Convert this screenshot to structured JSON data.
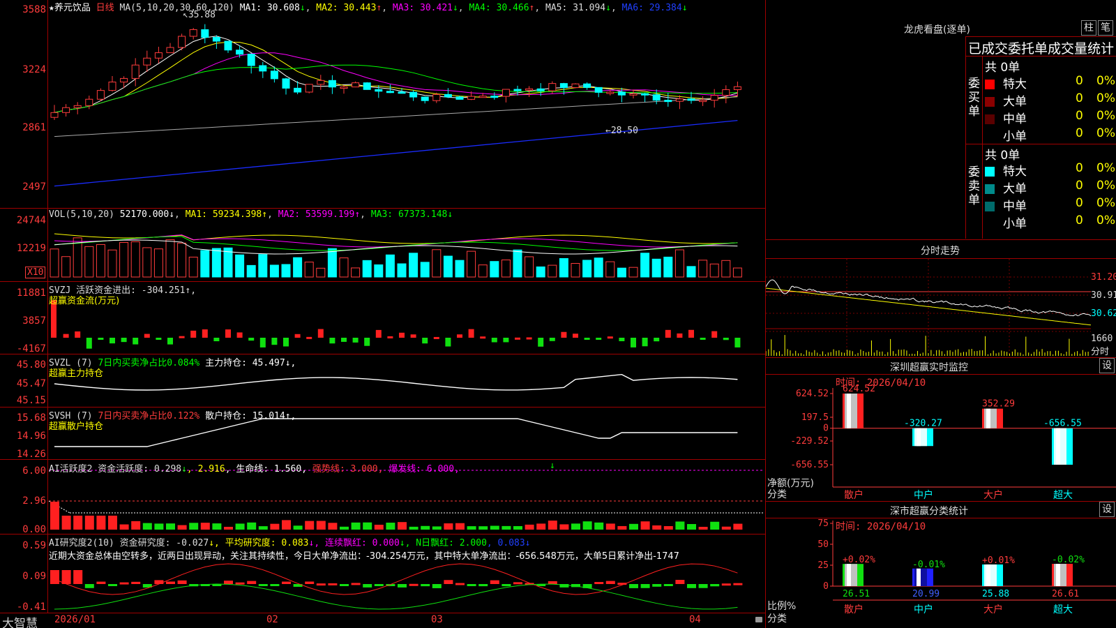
{
  "stock": {
    "name": "养元饮品",
    "period": "日线"
  },
  "main": {
    "ma_label": "MA(5,10,20,30,60,120)",
    "ma": [
      {
        "label": "MA1: 30.608",
        "dir": "↓",
        "color": "#ffffff"
      },
      {
        "label": "MA2: 30.443",
        "dir": "↑",
        "color": "#ffff00"
      },
      {
        "label": "MA3: 30.421",
        "dir": "↓",
        "color": "#ff00ff"
      },
      {
        "label": "MA4: 30.466",
        "dir": "↑",
        "color": "#00ff00"
      },
      {
        "label": "MA5: 31.094",
        "dir": "↓",
        "color": "#aaaaaa"
      },
      {
        "label": "MA6: 29.384",
        "dir": "↓",
        "color": "#0000ff"
      }
    ],
    "high_label": "35.88",
    "low_label": "28.50",
    "y_ticks": [
      "3588",
      "3224",
      "2861",
      "2497"
    ]
  },
  "vol": {
    "label": "VOL(5,10,20)",
    "value": "52170.000↓",
    "ma1": "MA1: 59234.398↑",
    "ma2": "MA2: 53599.199↑",
    "ma3": "MA3: 67373.148↓",
    "y_ticks": [
      "24744",
      "12219"
    ],
    "unit": "X10"
  },
  "svzj": {
    "title": "SVZJ  活跃资金进出: -304.251↑,",
    "subtitle": "超赢资金流(万元)",
    "y_ticks": [
      "11881",
      "3857",
      "-4167"
    ]
  },
  "svzl": {
    "title_a": "SVZL (7) ",
    "title_b": "7日内买卖净占比0.084%",
    "title_c": " 主力持仓: 45.497↓,",
    "subtitle": "超赢主力持仓",
    "y_ticks": [
      "45.80",
      "45.47",
      "45.15"
    ]
  },
  "svsh": {
    "title_a": "SVSH (7) ",
    "title_b": "7日内买卖净占比0.122%",
    "title_c": " 散户持仓: 15.014↑,",
    "subtitle": "超赢散户持仓",
    "y_ticks": [
      "15.68",
      "14.96",
      "14.26"
    ]
  },
  "ai_active": {
    "a": "AI活跃度2 资金活跃度: 0.298",
    "a_arrow": "↓",
    "b": ", 2.916",
    "c": ", 生命线: 1.560,",
    "d": " 强势线: 3.000,",
    "e": " 爆发线: 6.000,",
    "y_ticks": [
      "6.00",
      "2.96",
      "0.00"
    ],
    "marker": "↓"
  },
  "ai_research": {
    "a": "AI研究度2(10) 资金研究度: -0.027",
    "b": "↓, 平均研究度: 0.083",
    "c": "↓, 连续飘红: 0.000",
    "d": "↓, N日飘红: 2.000",
    "e": ", 0.083↓",
    "comment": "近期大资金总体由空转多，近两日出现异动，关注其持续性，今日大单净流出：-304.254万元，其中特大单净流出：-656.548万元，大单5日累计净出-1747",
    "y_ticks": [
      "0.59",
      "0.09",
      "-0.41"
    ]
  },
  "x_axis": [
    "2026/01",
    "02",
    "03",
    "04"
  ],
  "footer_brand": "大智慧",
  "dragon": {
    "title": "龙虎看盘(逐单)",
    "tab_zhu": "柱",
    "tab_bi": "笔",
    "header": "已成交委托单成交量统计",
    "buy_label": "委买单",
    "sell_label": "委卖单",
    "buy_total": "共 0单",
    "sell_total": "共 0单",
    "buy_rows": [
      {
        "name": "特大",
        "count": "0",
        "pct": "0%",
        "color": "#ff0000"
      },
      {
        "name": "大单",
        "count": "0",
        "pct": "0%",
        "color": "#8b0000"
      },
      {
        "name": "中单",
        "count": "0",
        "pct": "0%",
        "color": "#5a0000"
      },
      {
        "name": "小单",
        "count": "0",
        "pct": "0%",
        "color": "#000000"
      }
    ],
    "sell_rows": [
      {
        "name": "特大",
        "count": "0",
        "pct": "0%",
        "color": "#00ffff"
      },
      {
        "name": "大单",
        "count": "0",
        "pct": "0%",
        "color": "#008b8b"
      },
      {
        "name": "中单",
        "count": "0",
        "pct": "0%",
        "color": "#006b6b"
      },
      {
        "name": "小单",
        "count": "0",
        "pct": "0%",
        "color": "#000000"
      }
    ]
  },
  "intraday": {
    "title": "分时走势",
    "y_ticks": [
      "31.20",
      "30.91",
      "30.62"
    ],
    "vol_tick": "1660",
    "unit": "分时"
  },
  "monitor": {
    "title": "深圳超赢实时监控",
    "setting": "设",
    "time": "时间: 2026/04/10",
    "y_ticks": [
      "624.52",
      "197.5",
      "0",
      "-229.52",
      "-656.55"
    ],
    "ylabel": "净额(万元)",
    "xlabel": "分类",
    "bars": [
      {
        "cat": "散户",
        "value": 624.52,
        "label": "624.52"
      },
      {
        "cat": "中户",
        "value": -320.27,
        "label": "-320.27"
      },
      {
        "cat": "大户",
        "value": 352.29,
        "label": "352.29"
      },
      {
        "cat": "超大",
        "value": -656.55,
        "label": "-656.55"
      }
    ]
  },
  "classify": {
    "title": "深市超赢分类统计",
    "setting": "设",
    "time": "时间: 2026/04/10",
    "y_ticks": [
      "75",
      "50",
      "25",
      "0"
    ],
    "ylabel": "比例%",
    "xlabel": "分类",
    "bars": [
      {
        "cat": "散户",
        "value": 26.51,
        "label": "26.51",
        "delta": "+0.02%"
      },
      {
        "cat": "中户",
        "value": 20.99,
        "label": "20.99",
        "delta": "-0.01%"
      },
      {
        "cat": "大户",
        "value": 25.88,
        "label": "25.88",
        "delta": "+0.01%"
      },
      {
        "cat": "超大",
        "value": 26.61,
        "label": "26.61",
        "delta": "-0.02%"
      }
    ]
  },
  "chart_data": [
    {
      "type": "bar",
      "title": "深圳超赢实时监控",
      "categories": [
        "散户",
        "中户",
        "大户",
        "超大"
      ],
      "values": [
        624.52,
        -320.27,
        352.29,
        -656.55
      ],
      "ylabel": "净额(万元)",
      "xlabel": "分类",
      "ylim": [
        -656.55,
        624.52
      ]
    },
    {
      "type": "bar",
      "title": "深市超赢分类统计",
      "categories": [
        "散户",
        "中户",
        "大户",
        "超大"
      ],
      "values": [
        26.51,
        20.99,
        25.88,
        26.61
      ],
      "ylabel": "比例%",
      "xlabel": "分类",
      "ylim": [
        0,
        75
      ]
    }
  ]
}
